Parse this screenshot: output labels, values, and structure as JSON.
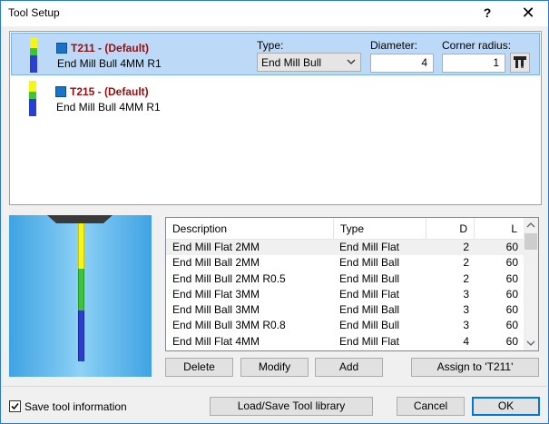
{
  "window": {
    "title": "Tool Setup",
    "help_label": "?",
    "close_label": "✕"
  },
  "tools": [
    {
      "name": "T211 - (Default)",
      "description": "End Mill Bull 4MM R1",
      "selected": true
    },
    {
      "name": "T215 - (Default)",
      "description": "End Mill Bull 4MM R1",
      "selected": false
    }
  ],
  "editor": {
    "type_label": "Type:",
    "type_value": "End Mill Bull",
    "diameter_label": "Diameter:",
    "diameter_value": "4",
    "corner_label": "Corner radius:",
    "corner_value": "1"
  },
  "library": {
    "headers": [
      "Description",
      "Type",
      "D",
      "L"
    ],
    "rows": [
      {
        "description": "End Mill Flat 2MM",
        "type": "End Mill Flat",
        "d": "2",
        "l": "60"
      },
      {
        "description": "End Mill Ball 2MM",
        "type": "End Mill Ball",
        "d": "2",
        "l": "60"
      },
      {
        "description": "End Mill Bull 2MM R0.5",
        "type": "End Mill Bull",
        "d": "2",
        "l": "60"
      },
      {
        "description": "End Mill Flat 3MM",
        "type": "End Mill Flat",
        "d": "3",
        "l": "60"
      },
      {
        "description": "End Mill Ball 3MM",
        "type": "End Mill Ball",
        "d": "3",
        "l": "60"
      },
      {
        "description": "End Mill Bull 3MM R0.8",
        "type": "End Mill Bull",
        "d": "3",
        "l": "60"
      },
      {
        "description": "End Mill Flat 4MM",
        "type": "End Mill Flat",
        "d": "4",
        "l": "60"
      }
    ]
  },
  "buttons": {
    "delete": "Delete",
    "modify": "Modify",
    "add": "Add",
    "assign": "Assign to 'T211'",
    "load_save": "Load/Save Tool library",
    "cancel": "Cancel",
    "ok": "OK"
  },
  "footer": {
    "save_info_label": "Save tool information",
    "save_info_checked": true
  },
  "colors": {
    "tool_name": "#9b0d0d",
    "selection_bg": "#bcdaf7",
    "tool_icon": "#1a73c9",
    "segment_yellow": "#f5f51a",
    "segment_green": "#3cc43c",
    "segment_blue": "#2a3fd0"
  },
  "icons": {
    "combo_arrow": "chevron-down-icon",
    "tool_picker": "tool-holder-icon",
    "checkbox": "check-icon"
  }
}
